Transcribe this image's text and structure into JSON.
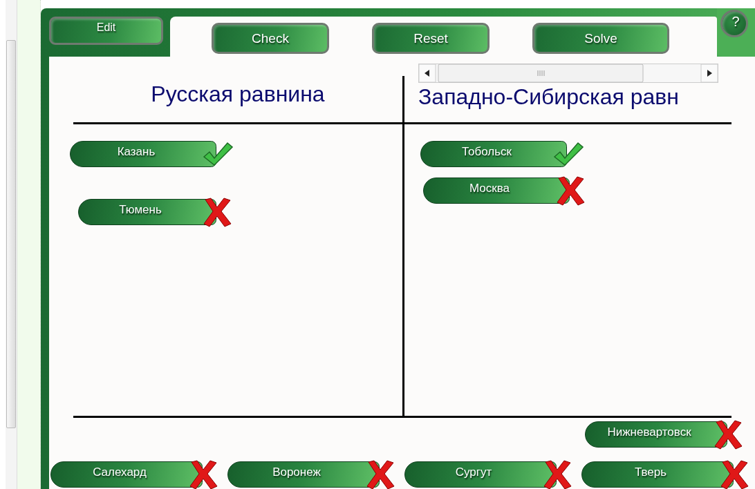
{
  "toolbar": {
    "edit": "Edit",
    "buttons": [
      "Check",
      "Reset",
      "Solve"
    ],
    "help": "?"
  },
  "columns": [
    {
      "title": "Русская равнина",
      "items": [
        {
          "label": "Казань",
          "correct": true
        },
        {
          "label": "Тюмень",
          "correct": false
        }
      ]
    },
    {
      "title": "Западно-Сибирская равн",
      "items": [
        {
          "label": "Тобольск",
          "correct": true
        },
        {
          "label": "Москва",
          "correct": false
        }
      ]
    }
  ],
  "tray": [
    {
      "label": "Нижневартовск",
      "correct": false
    },
    {
      "label": "Салехард",
      "correct": false
    },
    {
      "label": "Воронеж",
      "correct": false
    },
    {
      "label": "Сургут",
      "correct": false
    },
    {
      "label": "Тверь",
      "correct": false
    }
  ]
}
